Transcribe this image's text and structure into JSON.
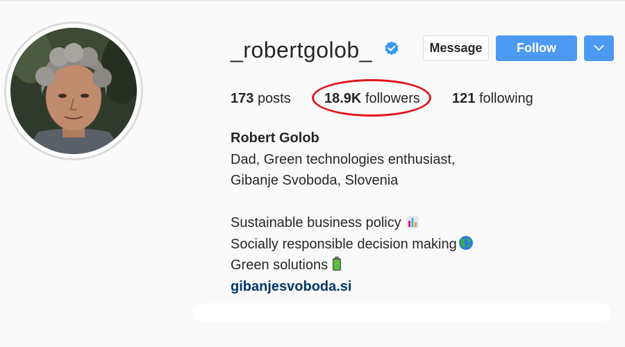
{
  "profile": {
    "username": "_robertgolob_",
    "verified": true,
    "full_name": "Robert Golob"
  },
  "actions": {
    "message_label": "Message",
    "follow_label": "Follow",
    "more_icon": "chevron-down-icon"
  },
  "stats": {
    "posts_count": "173",
    "posts_label": "posts",
    "followers_count": "18.9K",
    "followers_label": "followers",
    "following_count": "121",
    "following_label": "following"
  },
  "bio": {
    "line1": "Dad, Green technologies enthusiast,",
    "line2": "Gibanje Svoboda, Slovenia",
    "line3": "Sustainable business policy",
    "line3_icon": "bar-chart-icon",
    "line4": "Socially responsible decision making",
    "line4_icon": "globe-icon",
    "line5": "Green solutions",
    "line5_icon": "battery-icon",
    "link": "gibanjesvoboda.si"
  },
  "colors": {
    "follow_button": "#4c9af2",
    "verified_badge": "#3897f0",
    "highlight_circle": "#e3151a",
    "link": "#00376b"
  }
}
